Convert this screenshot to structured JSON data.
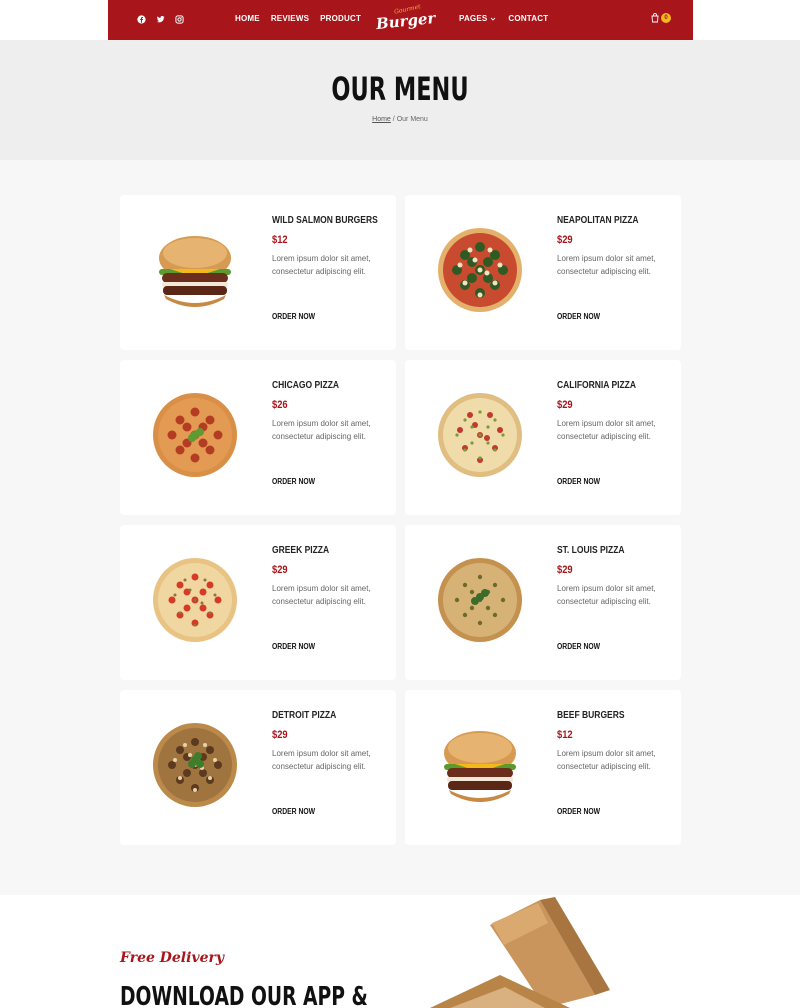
{
  "nav": {
    "left_links": [
      "HOME",
      "REVIEWS",
      "PRODUCT"
    ],
    "right_links": [
      "PAGES",
      "CONTACT"
    ],
    "logo_small": "Gourmet",
    "logo_main": "Burger",
    "cart_count": "0",
    "social_icons": [
      "facebook-icon",
      "twitter-icon",
      "instagram-icon"
    ]
  },
  "hero": {
    "title": "OUR MENU",
    "breadcrumb_home": "Home",
    "breadcrumb_sep": "/",
    "breadcrumb_current": "Our Menu"
  },
  "menu": [
    {
      "title": "WILD SALMON BURGERS",
      "price": "$12",
      "desc": "Lorem ipsum dolor sit amet, consectetur adipiscing elit.",
      "button": "ORDER NOW",
      "image": "burger"
    },
    {
      "title": "NEAPOLITAN PIZZA",
      "price": "$29",
      "desc": "Lorem ipsum dolor sit amet, consectetur adipiscing elit.",
      "button": "ORDER NOW",
      "image": "pizza-green"
    },
    {
      "title": "CHICAGO PIZZA",
      "price": "$26",
      "desc": "Lorem ipsum dolor sit amet, consectetur adipiscing elit.",
      "button": "ORDER NOW",
      "image": "pizza-pepperoni"
    },
    {
      "title": "CALIFORNIA PIZZA",
      "price": "$29",
      "desc": "Lorem ipsum dolor sit amet, consectetur adipiscing elit.",
      "button": "ORDER NOW",
      "image": "pizza-veg"
    },
    {
      "title": "GREEK PIZZA",
      "price": "$29",
      "desc": "Lorem ipsum dolor sit amet, consectetur adipiscing elit.",
      "button": "ORDER NOW",
      "image": "pizza-tomato"
    },
    {
      "title": "ST. LOUIS PIZZA",
      "price": "$29",
      "desc": "Lorem ipsum dolor sit amet, consectetur adipiscing elit.",
      "button": "ORDER NOW",
      "image": "pizza-herb"
    },
    {
      "title": "DETROIT PIZZA",
      "price": "$29",
      "desc": "Lorem ipsum dolor sit amet, consectetur adipiscing elit.",
      "button": "ORDER NOW",
      "image": "pizza-mushroom"
    },
    {
      "title": "BEEF BURGERS",
      "price": "$12",
      "desc": "Lorem ipsum dolor sit amet, consectetur adipiscing elit.",
      "button": "ORDER NOW",
      "image": "burger"
    }
  ],
  "app": {
    "tag": "Free Delivery",
    "title": "DOWNLOAD OUR APP &"
  },
  "colors": {
    "brand_red": "#a8151b",
    "accent_yellow": "#f3b81c",
    "hero_bg": "#eeeeee",
    "section_bg": "#f7f7f7"
  }
}
